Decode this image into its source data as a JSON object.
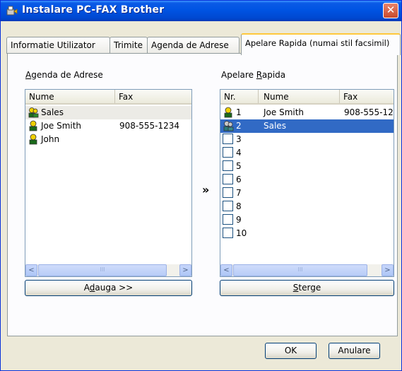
{
  "window": {
    "title": "Instalare PC-FAX Brother",
    "close_glyph": "✕"
  },
  "tabs": [
    {
      "label": "Informatie Utilizator"
    },
    {
      "label": "Trimite"
    },
    {
      "label": "Agenda de Adrese"
    },
    {
      "label": "Apelare Rapida (numai stil facsimil)",
      "active": true
    }
  ],
  "address_book": {
    "group_label_prefix": "A",
    "group_label_rest": "genda de Adrese",
    "columns": [
      "Nume",
      "Fax"
    ],
    "rows": [
      {
        "name": "Sales",
        "fax": "",
        "icon": "group-contact-icon"
      },
      {
        "name": "Joe Smith",
        "fax": "908-555-1234",
        "icon": "contact-icon"
      },
      {
        "name": "John",
        "fax": "",
        "icon": "contact-icon"
      }
    ],
    "add_button_pre": "A",
    "add_button_u": "d",
    "add_button_post": "auga >>"
  },
  "speed_dial": {
    "group_label_prefix": "Apelare ",
    "group_label_u": "R",
    "group_label_rest": "apida",
    "columns": [
      "Nr.",
      "Nume",
      "Fax"
    ],
    "rows": [
      {
        "nr": "1",
        "name": "Joe Smith",
        "fax": "908-555-12",
        "icon": "contact-icon"
      },
      {
        "nr": "2",
        "name": "Sales",
        "fax": "",
        "icon": "group-contact-icon",
        "selected": true
      },
      {
        "nr": "3",
        "name": "",
        "fax": ""
      },
      {
        "nr": "4",
        "name": "",
        "fax": ""
      },
      {
        "nr": "5",
        "name": "",
        "fax": ""
      },
      {
        "nr": "6",
        "name": "",
        "fax": ""
      },
      {
        "nr": "7",
        "name": "",
        "fax": ""
      },
      {
        "nr": "8",
        "name": "",
        "fax": ""
      },
      {
        "nr": "9",
        "name": "",
        "fax": ""
      },
      {
        "nr": "10",
        "name": "",
        "fax": ""
      }
    ],
    "delete_button_u": "S",
    "delete_button_rest": "terge"
  },
  "transfer_arrow": "»",
  "footer": {
    "ok_label": "OK",
    "cancel_label": "Anulare"
  },
  "scroll": {
    "left_glyph": "<",
    "right_glyph": ">",
    "thumb_glyph": "III"
  }
}
